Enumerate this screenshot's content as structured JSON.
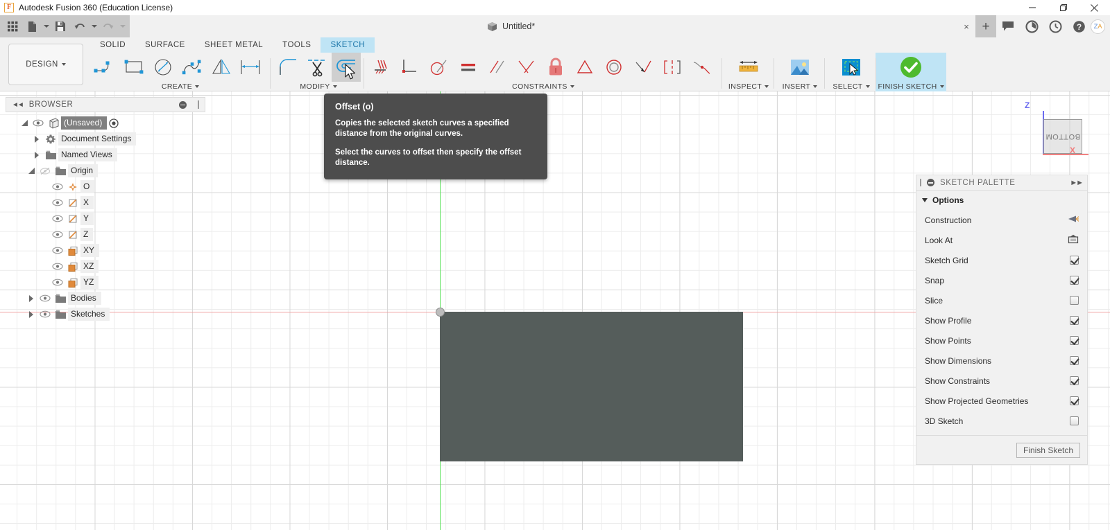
{
  "titlebar": {
    "app_title": "Autodesk Fusion 360 (Education License)",
    "logo_letter": "F",
    "minimize": "minimize-icon",
    "maximize": "restore-icon",
    "close": "close-icon"
  },
  "quick_access": {
    "grid_label": "app-grid-icon",
    "new_label": "new-document-icon",
    "save_label": "save-icon",
    "undo_label": "undo-icon",
    "redo_label": "redo-icon",
    "doc_tab_title": "Untitled*",
    "tab_close": "×",
    "new_tab": "+",
    "icons": [
      "comment-icon",
      "job-status-icon",
      "recent-icon",
      "help-icon"
    ],
    "avatar_initials": "ZA",
    "avatar_z": "Z",
    "avatar_a": "A"
  },
  "ribbon": {
    "workspace": "DESIGN",
    "tabs": [
      {
        "label": "SOLID",
        "active": false
      },
      {
        "label": "SURFACE",
        "active": false
      },
      {
        "label": "SHEET METAL",
        "active": false
      },
      {
        "label": "TOOLS",
        "active": false
      },
      {
        "label": "SKETCH",
        "active": true
      }
    ],
    "panels": [
      {
        "label": "CREATE",
        "has_caret": true
      },
      {
        "label": "MODIFY",
        "has_caret": true
      },
      {
        "label": "CONSTRAINTS",
        "has_caret": true
      },
      {
        "label": "INSPECT",
        "has_caret": true
      },
      {
        "label": "INSERT",
        "has_caret": true
      },
      {
        "label": "SELECT",
        "has_caret": true
      },
      {
        "label": "FINISH SKETCH",
        "has_caret": true
      }
    ],
    "create_tools": [
      "line-icon",
      "rectangle-icon",
      "circle-icon",
      "spline-icon",
      "mirror-icon",
      "dimension-icon"
    ],
    "modify_tools": [
      "fillet-icon",
      "trim-icon",
      "offset-icon"
    ],
    "modify_selected": "offset-icon",
    "constraint_tools": [
      "coincident-icon",
      "horizontal-vertical-icon",
      "tangent-icon",
      "equal-icon",
      "parallel-icon",
      "perpendicular-icon",
      "fix-unfix-icon",
      "midpoint-icon",
      "concentric-icon",
      "collinear-icon",
      "symmetry-icon",
      "curvature-icon"
    ]
  },
  "tooltip": {
    "title": "Offset (o)",
    "body1": "Copies the selected sketch curves a specified distance from the original curves.",
    "body2": "Select the curves to offset then specify the offset distance."
  },
  "browser": {
    "header": "BROWSER",
    "collapse_icon": "collapse-left-icon",
    "minimize_icon": "minimize-panel-icon",
    "items": [
      {
        "label": "(Unsaved)",
        "indent": 0,
        "expander": "down",
        "eye": true,
        "icon": "component-icon",
        "selected": true,
        "radio": true
      },
      {
        "label": "Document Settings",
        "indent": 1,
        "expander": "right",
        "eye": false,
        "icon": "gear-icon",
        "selected": false,
        "radio": false
      },
      {
        "label": "Named Views",
        "indent": 1,
        "expander": "right",
        "eye": false,
        "icon": "folder-icon",
        "selected": false,
        "radio": false
      },
      {
        "label": "Origin",
        "indent": 1,
        "expander": "down",
        "eye": "off",
        "icon": "folder-icon",
        "selected": false,
        "radio": false
      },
      {
        "label": "O",
        "indent": 2,
        "expander": "none",
        "eye": true,
        "icon": "origin-point-icon",
        "selected": false,
        "radio": false
      },
      {
        "label": "X",
        "indent": 2,
        "expander": "none",
        "eye": true,
        "icon": "axis-icon",
        "selected": false,
        "radio": false
      },
      {
        "label": "Y",
        "indent": 2,
        "expander": "none",
        "eye": true,
        "icon": "axis-icon",
        "selected": false,
        "radio": false
      },
      {
        "label": "Z",
        "indent": 2,
        "expander": "none",
        "eye": true,
        "icon": "axis-icon",
        "selected": false,
        "radio": false
      },
      {
        "label": "XY",
        "indent": 2,
        "expander": "none",
        "eye": true,
        "icon": "plane-icon",
        "selected": false,
        "radio": false
      },
      {
        "label": "XZ",
        "indent": 2,
        "expander": "none",
        "eye": true,
        "icon": "plane-icon",
        "selected": false,
        "radio": false
      },
      {
        "label": "YZ",
        "indent": 2,
        "expander": "none",
        "eye": true,
        "icon": "plane-icon",
        "selected": false,
        "radio": false
      },
      {
        "label": "Bodies",
        "indent": 1,
        "expander": "right",
        "eye": true,
        "icon": "folder-icon",
        "selected": false,
        "radio": false
      },
      {
        "label": "Sketches",
        "indent": 1,
        "expander": "right",
        "eye": true,
        "icon": "folder-icon",
        "selected": false,
        "radio": false
      }
    ]
  },
  "sketch_palette": {
    "header": "SKETCH PALETTE",
    "section_options": "Options",
    "rows": [
      {
        "label": "Construction",
        "control": "icon",
        "icon": "construction-icon",
        "checked": false
      },
      {
        "label": "Look At",
        "control": "icon",
        "icon": "look-at-icon",
        "checked": false
      },
      {
        "label": "Sketch Grid",
        "control": "checkbox",
        "checked": true
      },
      {
        "label": "Snap",
        "control": "checkbox",
        "checked": true
      },
      {
        "label": "Slice",
        "control": "checkbox",
        "checked": false
      },
      {
        "label": "Show Profile",
        "control": "checkbox",
        "checked": true
      },
      {
        "label": "Show Points",
        "control": "checkbox",
        "checked": true
      },
      {
        "label": "Show Dimensions",
        "control": "checkbox",
        "checked": true
      },
      {
        "label": "Show Constraints",
        "control": "checkbox",
        "checked": true
      },
      {
        "label": "Show Projected Geometries",
        "control": "checkbox",
        "checked": true
      },
      {
        "label": "3D Sketch",
        "control": "checkbox",
        "checked": false
      }
    ],
    "finish_button": "Finish Sketch"
  },
  "viewcube": {
    "face_label": "BOTTOM",
    "z_axis": "Z",
    "x_axis": "X"
  },
  "canvas": {
    "profile_fill": "#555d5b",
    "x_axis_color": "#f0a0a0",
    "y_axis_color": "#55e055",
    "grid_minor_color": "#ececec",
    "grid_major_color": "#d8d8d8"
  }
}
